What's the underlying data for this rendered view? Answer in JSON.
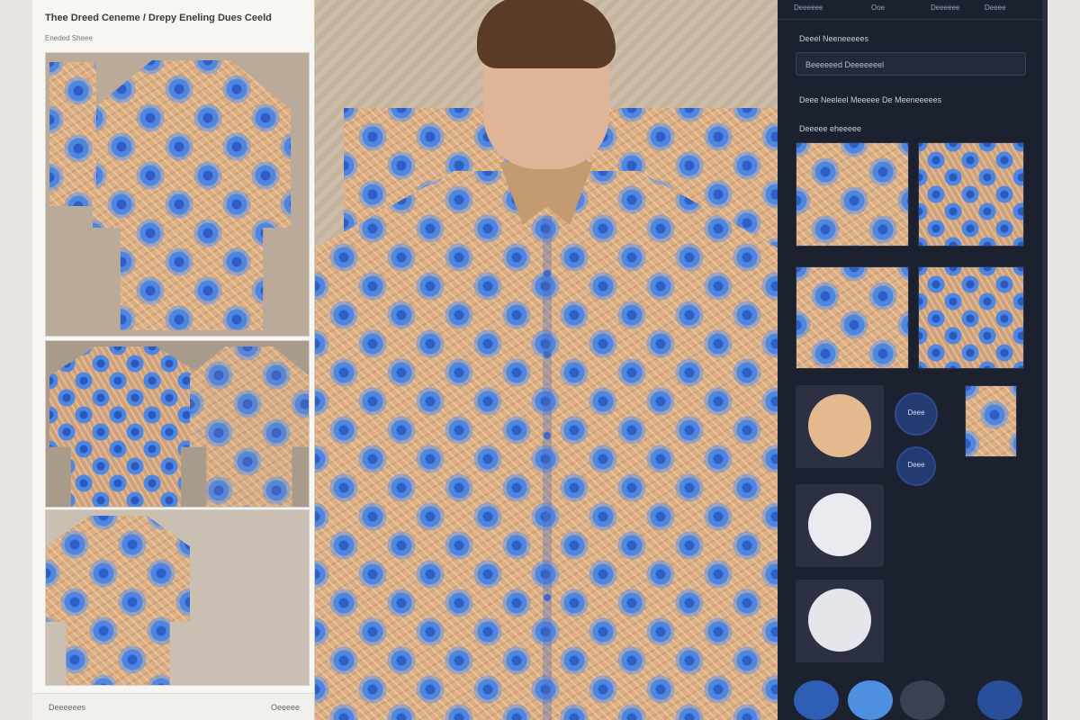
{
  "left_panel": {
    "title": "Thee Dreed Ceneme / Drepy Eneling Dues Ceeld",
    "subtitle": "Eneded Sheee",
    "footer_left": "Deeeeees",
    "footer_right": "Oeeeee"
  },
  "right_panel": {
    "top_bar": [
      "Deeeeee",
      "Ooe",
      "Deeeeee",
      "Deeee"
    ],
    "section_1_label": "Deeel Neeneeeees",
    "field_value": "Beeeeeed Deeeeeeel",
    "section_2_label": "Deee Neeleel Meeeee De Meeneeeees",
    "section_3_label": "Deeeee eheeeee",
    "round_button_1": "Deee",
    "round_button_2": "Deee",
    "colors": {
      "tan": "#e3b98d",
      "white": "#e9ebf0",
      "light_gray": "#e4e6eb",
      "navy": "#233a73",
      "bottom": [
        "#2f5fb4",
        "#4f8fe0",
        "#3a4150",
        "#2a4f9a"
      ]
    }
  }
}
